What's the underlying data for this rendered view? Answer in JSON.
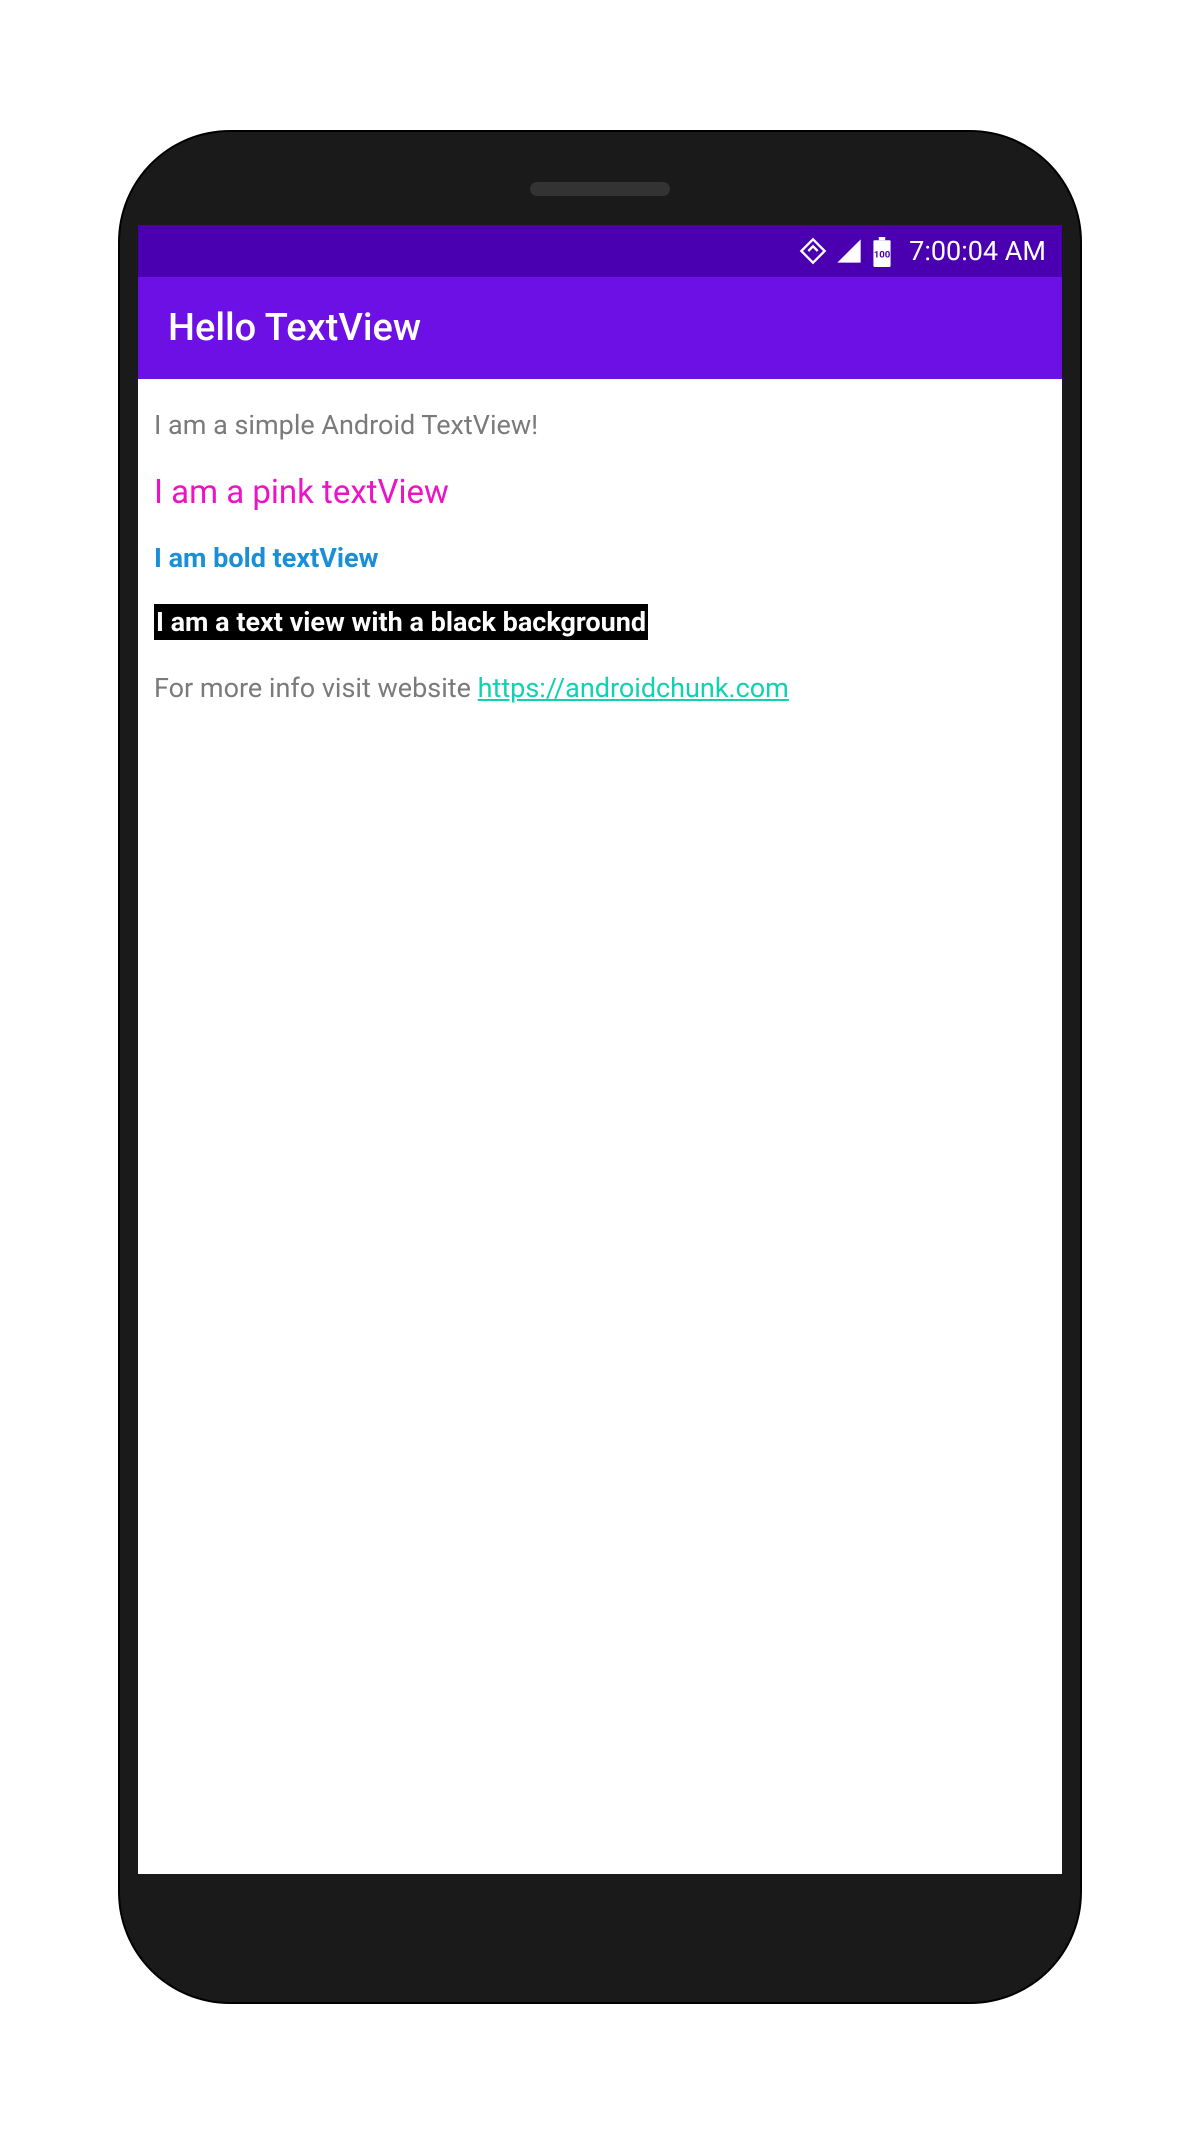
{
  "status_bar": {
    "time": "7:00:04 AM",
    "battery_label": "100"
  },
  "app_bar": {
    "title": "Hello TextView"
  },
  "content": {
    "simple": "I am a simple Android TextView!",
    "pink": "I am a pink textView",
    "bold": "I am bold textView",
    "blackbg": "I am a text view with a black background",
    "info_prefix": "For more info visit website ",
    "link_text": "https://androidchunk.com"
  },
  "colors": {
    "status_bar_bg": "#4a00b0",
    "app_bar_bg": "#6d10e6",
    "pink": "#ec13c6",
    "blue": "#1a8fd6",
    "link": "#11d1b0",
    "gray_text": "#7a7a7a"
  }
}
